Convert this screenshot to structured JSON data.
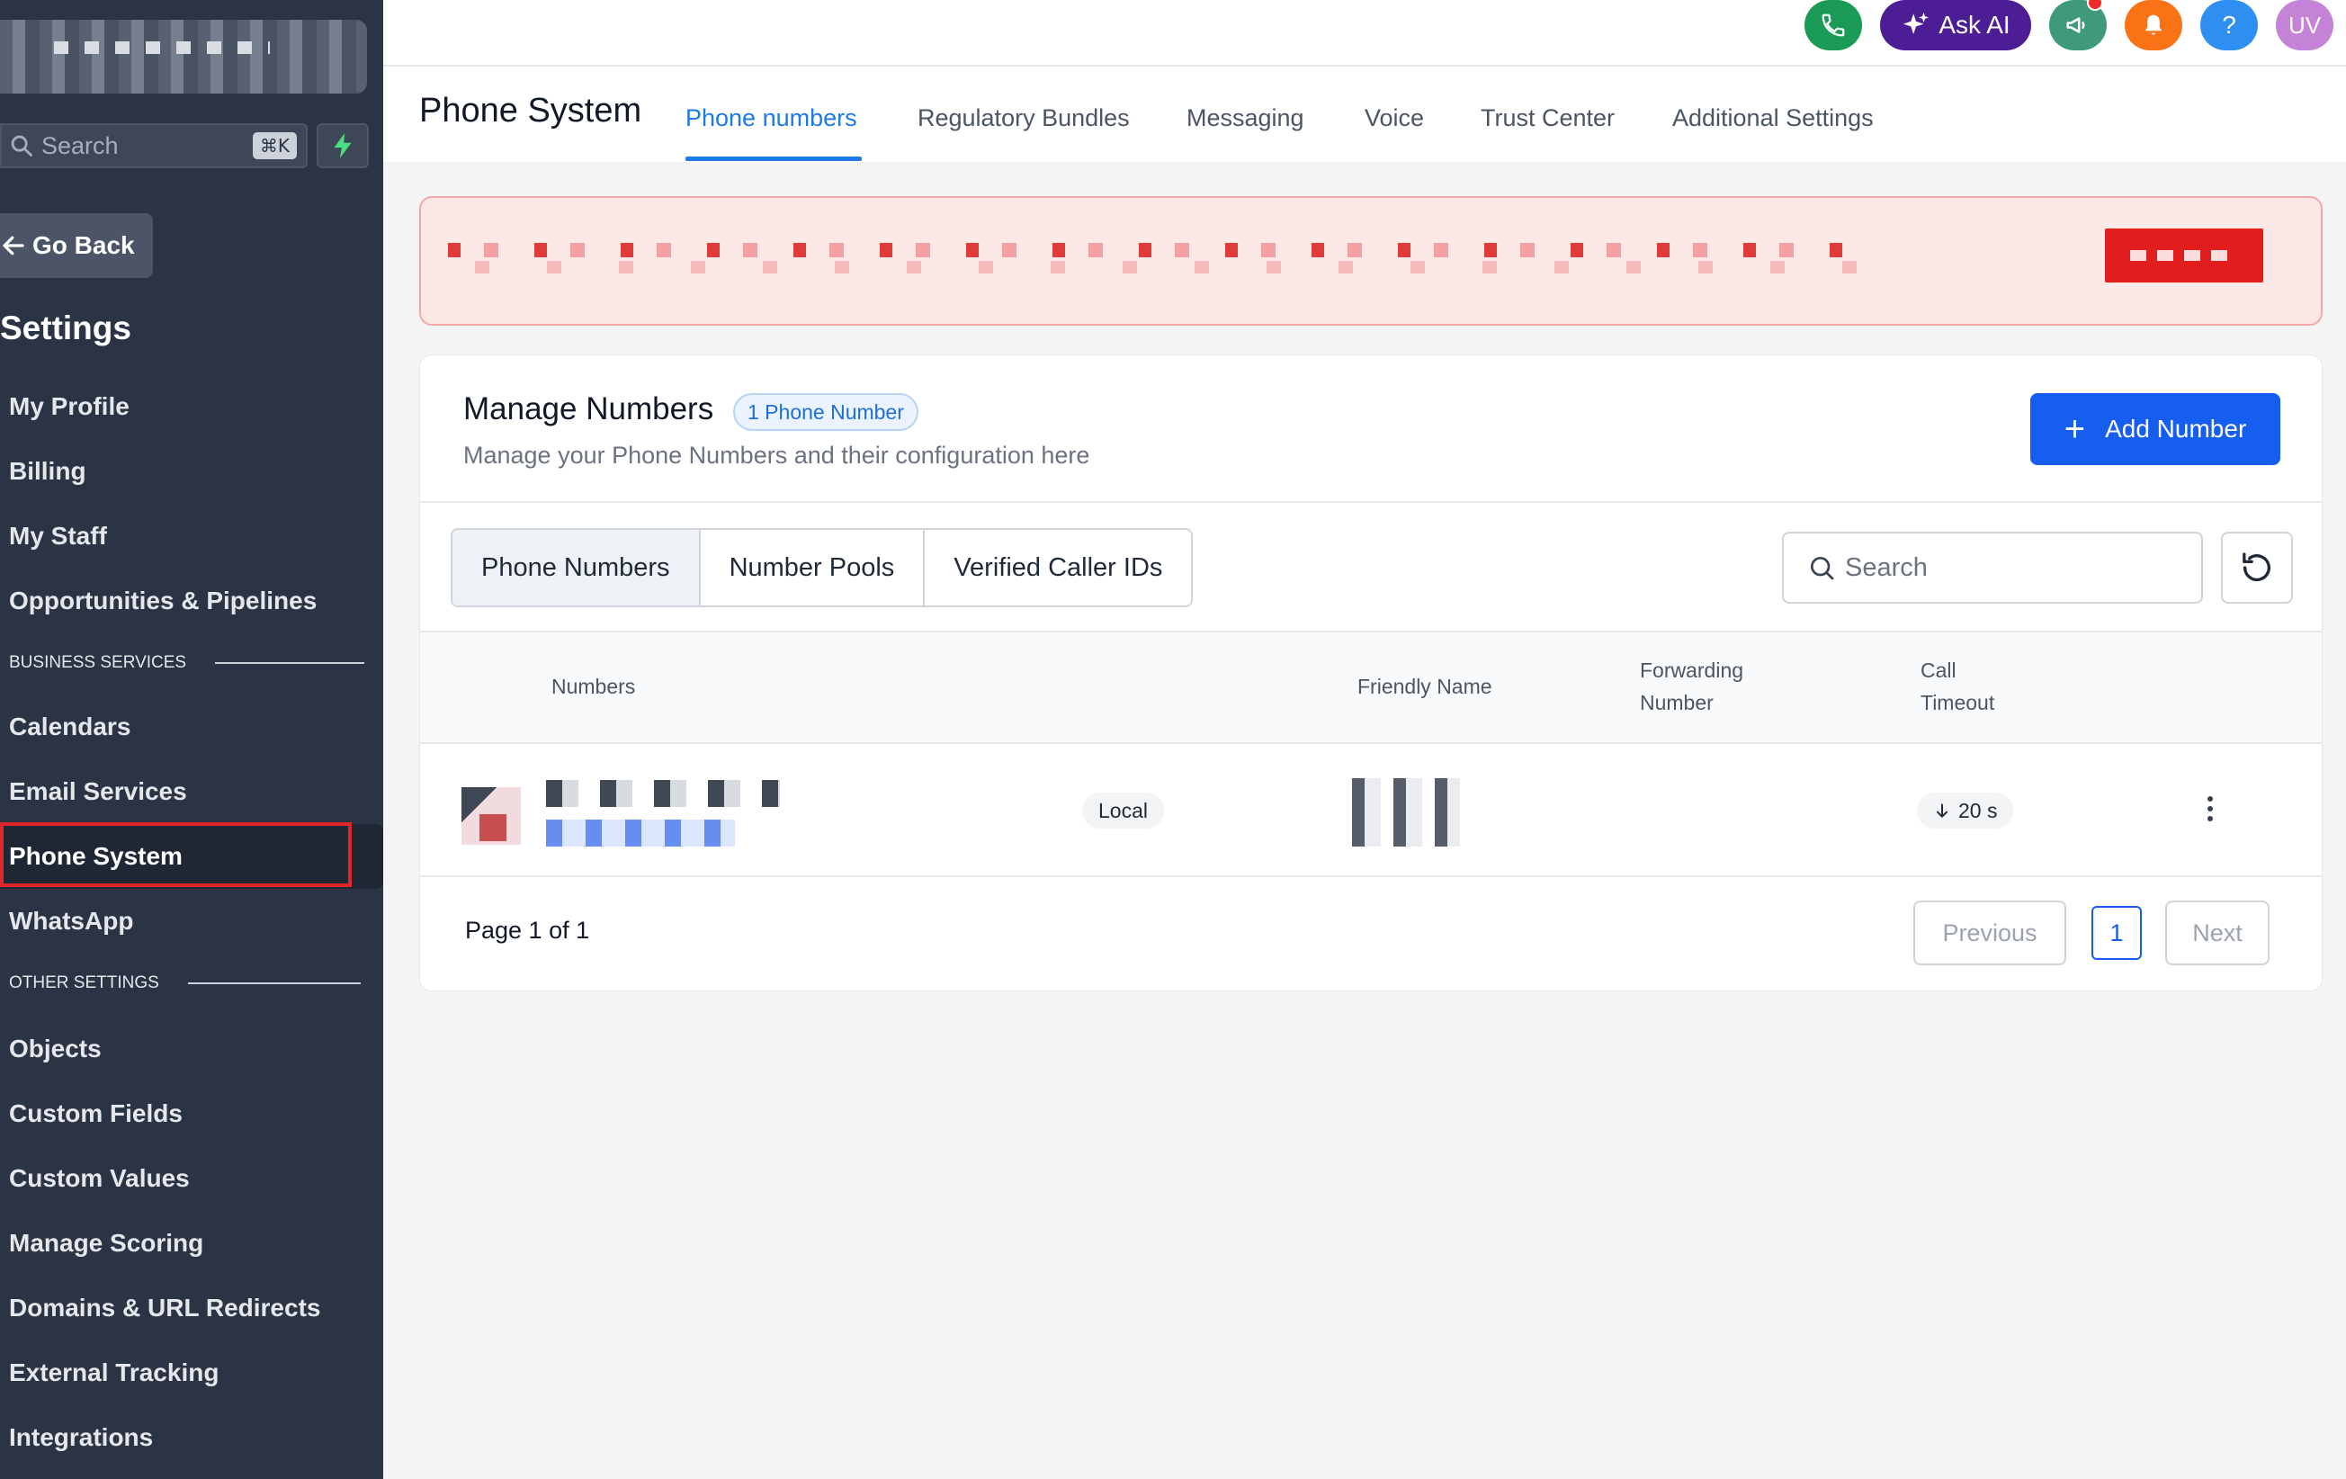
{
  "sidebar": {
    "search_placeholder": "Search",
    "search_shortcut": "⌘K",
    "go_back": "Go Back",
    "title": "Settings",
    "items": [
      {
        "label": "My Profile"
      },
      {
        "label": "Billing"
      },
      {
        "label": "My Staff"
      },
      {
        "label": "Opportunities & Pipelines"
      }
    ],
    "section_business": "BUSINESS SERVICES",
    "business_items": [
      {
        "label": "Calendars"
      },
      {
        "label": "Email Services"
      },
      {
        "label": "Phone System"
      },
      {
        "label": "WhatsApp"
      }
    ],
    "section_other": "OTHER SETTINGS",
    "other_items": [
      {
        "label": "Objects"
      },
      {
        "label": "Custom Fields"
      },
      {
        "label": "Custom Values"
      },
      {
        "label": "Manage Scoring"
      },
      {
        "label": "Domains & URL Redirects"
      },
      {
        "label": "External Tracking"
      },
      {
        "label": "Integrations"
      }
    ]
  },
  "topbar": {
    "ask_ai": "Ask AI",
    "help": "?",
    "avatar": "UV",
    "colors": {
      "phone": "#1a9b55",
      "ask_ai": "#4c1d95",
      "announce": "#3f9a7a",
      "bell": "#f97316",
      "help": "#2f8ff0",
      "avatar": "#c483d6"
    }
  },
  "header": {
    "title": "Phone System",
    "tabs": [
      {
        "label": "Phone numbers"
      },
      {
        "label": "Regulatory Bundles"
      },
      {
        "label": "Messaging"
      },
      {
        "label": "Voice"
      },
      {
        "label": "Trust Center"
      },
      {
        "label": "Additional Settings"
      }
    ]
  },
  "card": {
    "title": "Manage Numbers",
    "count_badge": "1 Phone Number",
    "subtitle": "Manage your Phone Numbers and their configuration here",
    "add_button": "Add Number",
    "segments": [
      {
        "label": "Phone Numbers"
      },
      {
        "label": "Number Pools"
      },
      {
        "label": "Verified Caller IDs"
      }
    ],
    "search_placeholder": "Search",
    "columns": {
      "numbers": "Numbers",
      "friendly_name": "Friendly Name",
      "forwarding_1": "Forwarding",
      "forwarding_2": "Number",
      "timeout_1": "Call",
      "timeout_2": "Timeout"
    },
    "row": {
      "type": "Local",
      "timeout": "20 s"
    },
    "pagination": {
      "info": "Page 1 of 1",
      "previous": "Previous",
      "current": "1",
      "next": "Next"
    }
  }
}
